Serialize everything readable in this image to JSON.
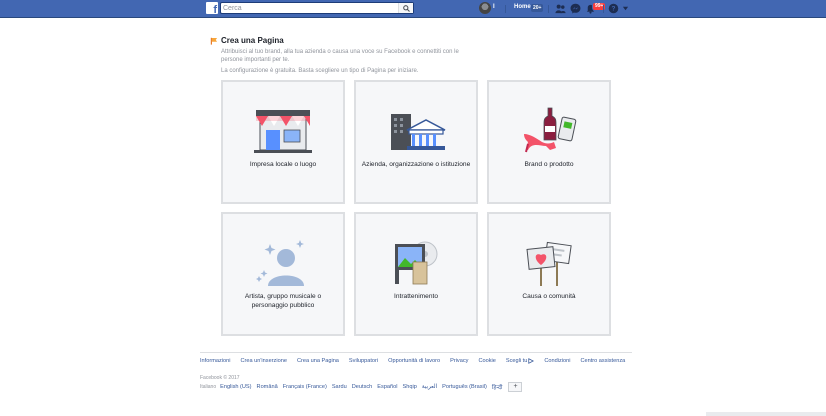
{
  "topbar": {
    "logo": "f",
    "search_placeholder": "Cerca",
    "user_name": "I",
    "home_label": "Home",
    "home_count": "20+",
    "notifications_count": "99+",
    "colors": {
      "bar": "#4267b2",
      "badge": "#fa3e3e"
    }
  },
  "page": {
    "title": "Crea una Pagina",
    "intro_line1": "Attribuisci al tuo brand, alla tua azienda o causa una voce su Facebook e connettiti con le persone importanti per te.",
    "intro_line2": "La configurazione è gratuita. Basta scegliere un tipo di Pagina per iniziare."
  },
  "categories": [
    {
      "label": "Impresa locale o luogo",
      "icon": "storefront-icon"
    },
    {
      "label": "Azienda, organizzazione o istituzione",
      "icon": "building-icon"
    },
    {
      "label": "Brand o prodotto",
      "icon": "brand-products-icon"
    },
    {
      "label": "Artista, gruppo musicale o personaggio pubblico",
      "icon": "public-figure-icon"
    },
    {
      "label": "Intrattenimento",
      "icon": "entertainment-icon"
    },
    {
      "label": "Causa o comunità",
      "icon": "signs-icon"
    }
  ],
  "footer": {
    "links": [
      "Informazioni",
      "Crea un'inserzione",
      "Crea una Pagina",
      "Sviluppatori",
      "Opportunità di lavoro",
      "Privacy",
      "Cookie",
      "Scegli tu",
      "Condizioni",
      "Centro assistenza"
    ],
    "copyright": "Facebook © 2017",
    "current_language": "Italiano",
    "languages": [
      "English (US)",
      "Română",
      "Français (France)",
      "Sardu",
      "Deutsch",
      "Español",
      "Shqip",
      "العربية",
      "Português (Brasil)",
      "हिन्दी"
    ],
    "more_languages": "+"
  }
}
